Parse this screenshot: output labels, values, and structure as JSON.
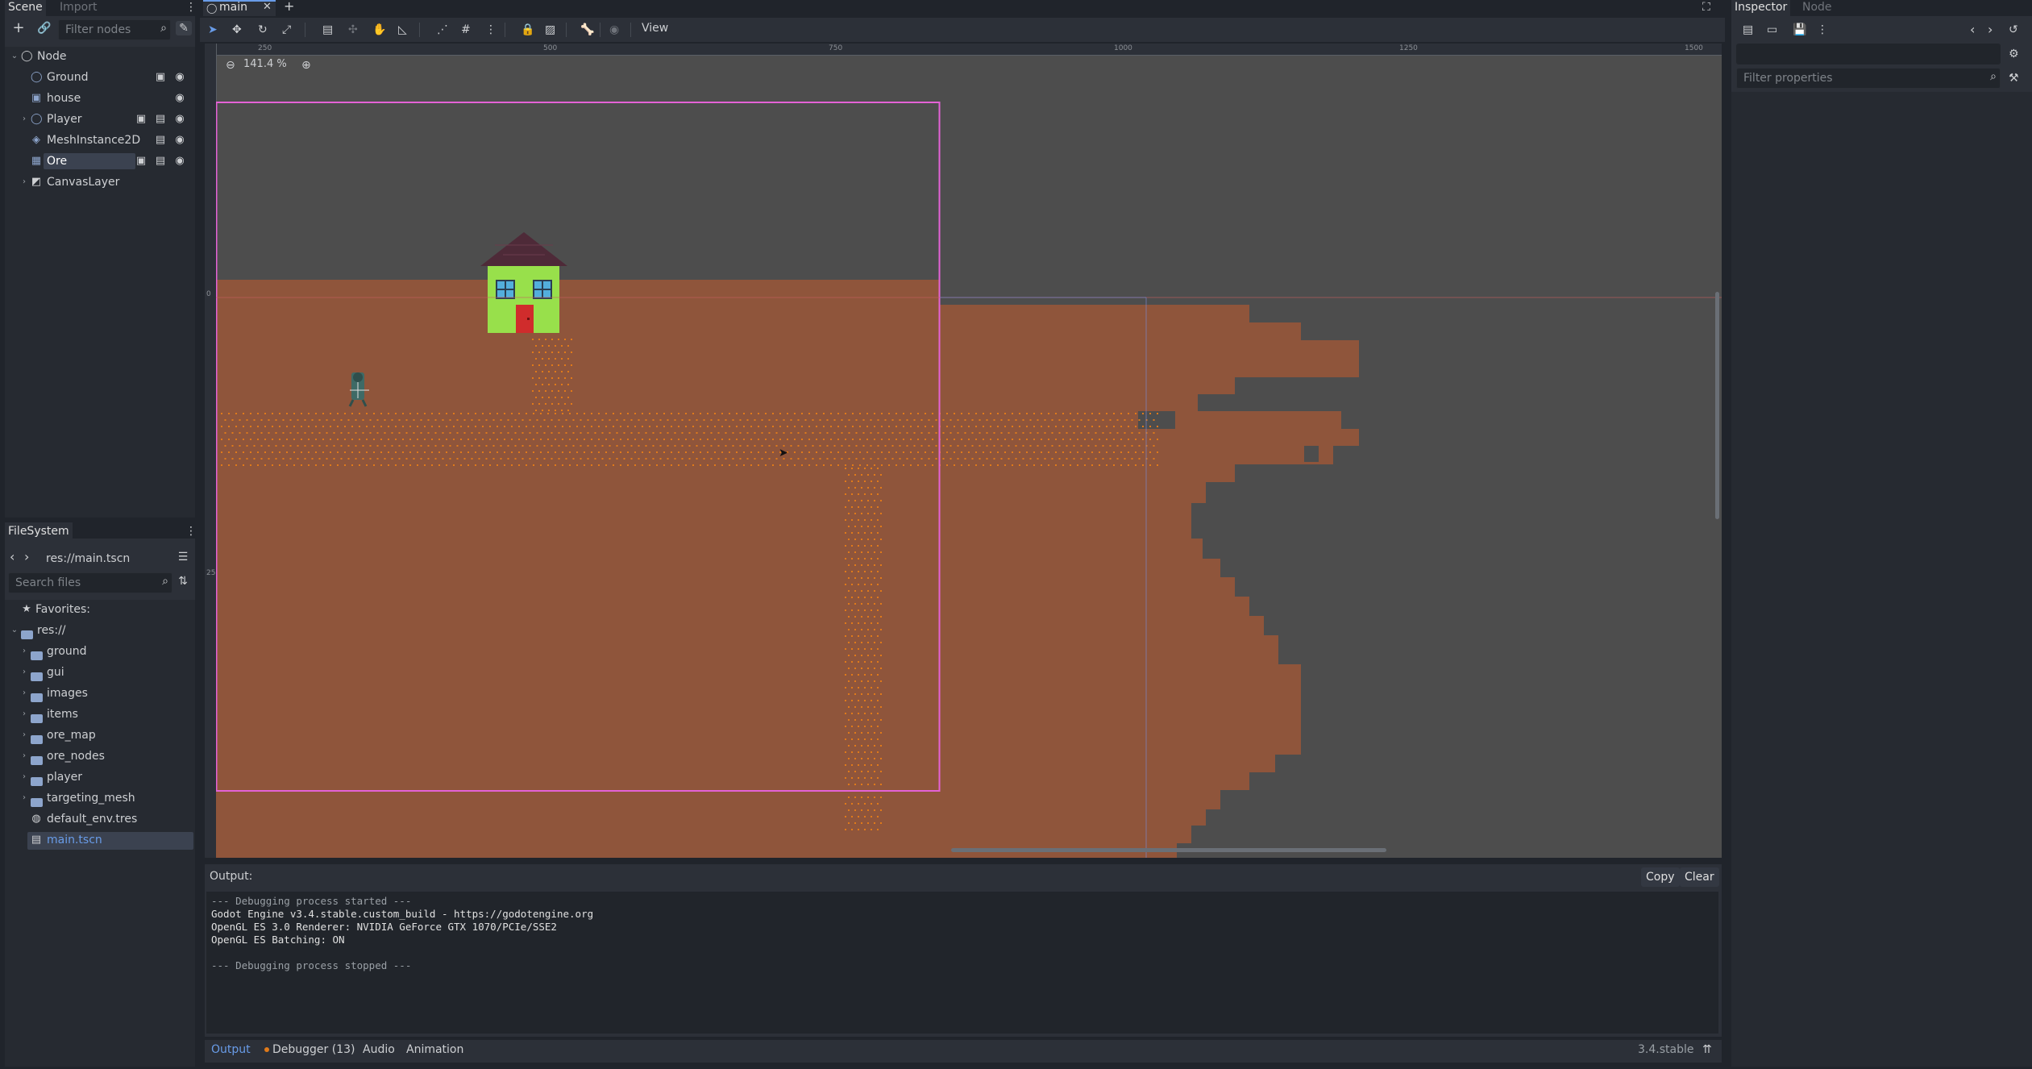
{
  "scene_dock": {
    "tabs": [
      "Scene",
      "Import"
    ],
    "filter_placeholder": "Filter nodes",
    "nodes": [
      {
        "label": "Node",
        "icon": "node-circle-icon"
      },
      {
        "label": "Ground",
        "icon": "node2d-circle-icon"
      },
      {
        "label": "house",
        "icon": "sprite-icon"
      },
      {
        "label": "Player",
        "icon": "node2d-circle-icon"
      },
      {
        "label": "MeshInstance2D",
        "icon": "mesh-icon"
      },
      {
        "label": "Ore",
        "icon": "tilemap-icon"
      },
      {
        "label": "CanvasLayer",
        "icon": "canvaslayer-icon"
      }
    ]
  },
  "filesystem": {
    "title": "FileSystem",
    "path": "res://main.tscn",
    "search_placeholder": "Search files",
    "favorites_label": "Favorites:",
    "root_label": "res://",
    "items": [
      {
        "label": "ground",
        "type": "folder"
      },
      {
        "label": "gui",
        "type": "folder"
      },
      {
        "label": "images",
        "type": "folder"
      },
      {
        "label": "items",
        "type": "folder"
      },
      {
        "label": "ore_map",
        "type": "folder"
      },
      {
        "label": "ore_nodes",
        "type": "folder"
      },
      {
        "label": "player",
        "type": "folder"
      },
      {
        "label": "targeting_mesh",
        "type": "folder"
      },
      {
        "label": "default_env.tres",
        "type": "resource"
      },
      {
        "label": "main.tscn",
        "type": "scene",
        "selected": true
      }
    ]
  },
  "editor": {
    "scene_tab": "main",
    "view_menu": "View",
    "zoom": "141.4 %",
    "ruler_labels": [
      "250",
      "500",
      "750",
      "1000",
      "1250",
      "1500"
    ],
    "vruler_labels": [
      "0",
      "250"
    ]
  },
  "output": {
    "title": "Output:",
    "copy_label": "Copy",
    "clear_label": "Clear",
    "lines": [
      "--- Debugging process started ---",
      "Godot Engine v3.4.stable.custom_build - https://godotengine.org",
      "OpenGL ES 3.0 Renderer: NVIDIA GeForce GTX 1070/PCIe/SSE2",
      "OpenGL ES Batching: ON",
      "",
      "--- Debugging process stopped ---"
    ]
  },
  "bottom_bar": {
    "tabs": [
      "Output",
      "Debugger (13)",
      "Audio",
      "Animation"
    ],
    "version": "3.4.stable"
  },
  "inspector": {
    "tabs": [
      "Inspector",
      "Node"
    ],
    "filter_placeholder": "Filter properties"
  },
  "colors": {
    "accent": "#699ce8",
    "ground": "#8f553b",
    "sky": "#4d4d4d",
    "ore": "#e07a1a",
    "house_wall": "#98e04b",
    "house_roof": "#4e2a38",
    "door": "#d02c2c",
    "camera_rect": "#e462d6"
  }
}
